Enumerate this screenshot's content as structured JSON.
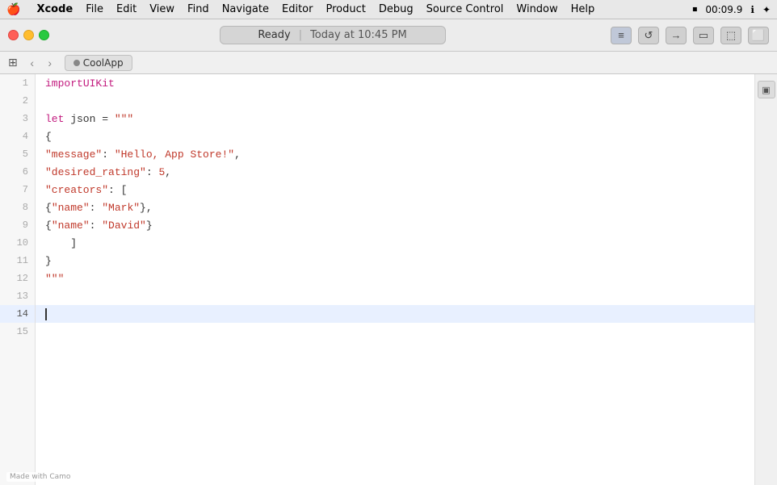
{
  "menubar": {
    "apple": "🍎",
    "items": [
      {
        "id": "xcode",
        "label": "Xcode",
        "bold": true
      },
      {
        "id": "file",
        "label": "File",
        "bold": false
      },
      {
        "id": "edit",
        "label": "Edit",
        "bold": false
      },
      {
        "id": "view",
        "label": "View",
        "bold": false
      },
      {
        "id": "find",
        "label": "Find",
        "bold": false
      },
      {
        "id": "navigate",
        "label": "Navigate",
        "bold": false
      },
      {
        "id": "editor",
        "label": "Editor",
        "bold": false
      },
      {
        "id": "product",
        "label": "Product",
        "bold": false
      },
      {
        "id": "debug",
        "label": "Debug",
        "bold": false
      },
      {
        "id": "source-control",
        "label": "Source Control",
        "bold": false
      },
      {
        "id": "window",
        "label": "Window",
        "bold": false
      },
      {
        "id": "help",
        "label": "Help",
        "bold": false
      }
    ],
    "right": {
      "recording_indicator": "⏹",
      "timer": "00:09.9",
      "info_icon": "ℹ",
      "extra_icon": "✦"
    }
  },
  "titlebar": {
    "status_label": "Ready",
    "status_sep": "|",
    "status_time": "Today at 10:45 PM",
    "icons": [
      {
        "id": "align-left",
        "symbol": "≡",
        "active": true
      },
      {
        "id": "refresh",
        "symbol": "↺",
        "active": false
      },
      {
        "id": "arrow-right",
        "symbol": "→",
        "active": false
      },
      {
        "id": "layout-1",
        "symbol": "▭",
        "active": false
      },
      {
        "id": "layout-2",
        "symbol": "⬚",
        "active": false
      },
      {
        "id": "layout-3",
        "symbol": "⬜",
        "active": false
      }
    ]
  },
  "tabbar": {
    "grid_icon": "⊞",
    "back_label": "‹",
    "forward_label": "›",
    "tab": {
      "dot_color": "#888888",
      "label": "CoolApp"
    }
  },
  "editor": {
    "lines": [
      {
        "num": 1,
        "active": false,
        "content_html": "<span class='kw'>import</span> <span class='type'>UIKit</span>"
      },
      {
        "num": 2,
        "active": false,
        "content_html": ""
      },
      {
        "num": 3,
        "active": false,
        "content_html": "<span class='kw'>let</span> json = <span class='str'>\"\"\"</span>"
      },
      {
        "num": 4,
        "active": false,
        "content_html": "<span class='brace'>{</span>"
      },
      {
        "num": 5,
        "active": false,
        "content_html": "    <span class='key'>\"message\"</span>: <span class='val'>\"Hello, App Store!\"</span>,"
      },
      {
        "num": 6,
        "active": false,
        "content_html": "    <span class='key'>\"desired_rating\"</span>: <span class='val'>5</span>,"
      },
      {
        "num": 7,
        "active": false,
        "content_html": "    <span class='key'>\"creators\"</span>: ["
      },
      {
        "num": 8,
        "active": false,
        "content_html": "        <span class='brace'>{</span> <span class='key'>\"name\"</span>: <span class='val'>\"Mark\"</span> <span class='brace'>}</span>,"
      },
      {
        "num": 9,
        "active": false,
        "content_html": "        <span class='brace'>{</span> <span class='key'>\"name\"</span>: <span class='val'>\"David\"</span> <span class='brace'>}</span>"
      },
      {
        "num": 10,
        "active": false,
        "content_html": "    ]"
      },
      {
        "num": 11,
        "active": false,
        "content_html": "<span class='brace'>}</span>"
      },
      {
        "num": 12,
        "active": false,
        "content_html": "<span class='str'>\"\"\"</span>"
      },
      {
        "num": 13,
        "active": false,
        "content_html": ""
      },
      {
        "num": 14,
        "active": true,
        "content_html": ""
      },
      {
        "num": 15,
        "active": false,
        "content_html": ""
      }
    ]
  },
  "right_sidebar": {
    "icon_symbol": "▣"
  },
  "watermark": {
    "text": "Made with Camo"
  }
}
